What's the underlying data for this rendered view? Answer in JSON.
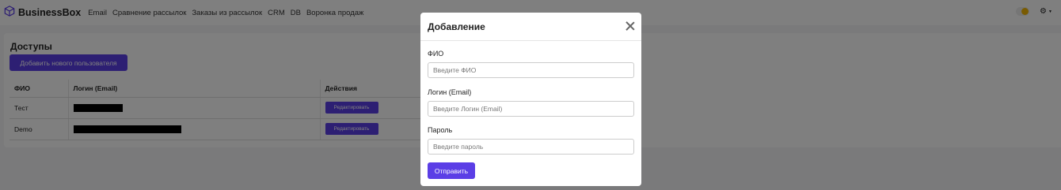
{
  "brand": {
    "name": "BusinessBox",
    "icon": "cube-logo-icon"
  },
  "nav": [
    "Email",
    "Сравнение рассылок",
    "Заказы из рассылок",
    "CRM",
    "DB",
    "Воронка продаж"
  ],
  "colors": {
    "accent": "#5b3ee6",
    "toggle_knob": "#f2b705",
    "overlay": "rgba(0,0,0,0.5)"
  },
  "page": {
    "title": "Доступы",
    "add_button": "Добавить нового пользователя",
    "table": {
      "headers": [
        "ФИО",
        "Логин (Email)",
        "Действия"
      ],
      "rows": [
        {
          "fio": "Тест",
          "action": "Редактировать"
        },
        {
          "fio": "Demo",
          "action": "Редактировать"
        }
      ]
    }
  },
  "modal": {
    "title": "Добавление",
    "fields": [
      {
        "label": "ФИО",
        "placeholder": "Введите ФИО"
      },
      {
        "label": "Логин (Email)",
        "placeholder": "Введите Логин (Email)"
      },
      {
        "label": "Пароль",
        "placeholder": "Введите пароль"
      }
    ],
    "submit": "Отправить"
  }
}
